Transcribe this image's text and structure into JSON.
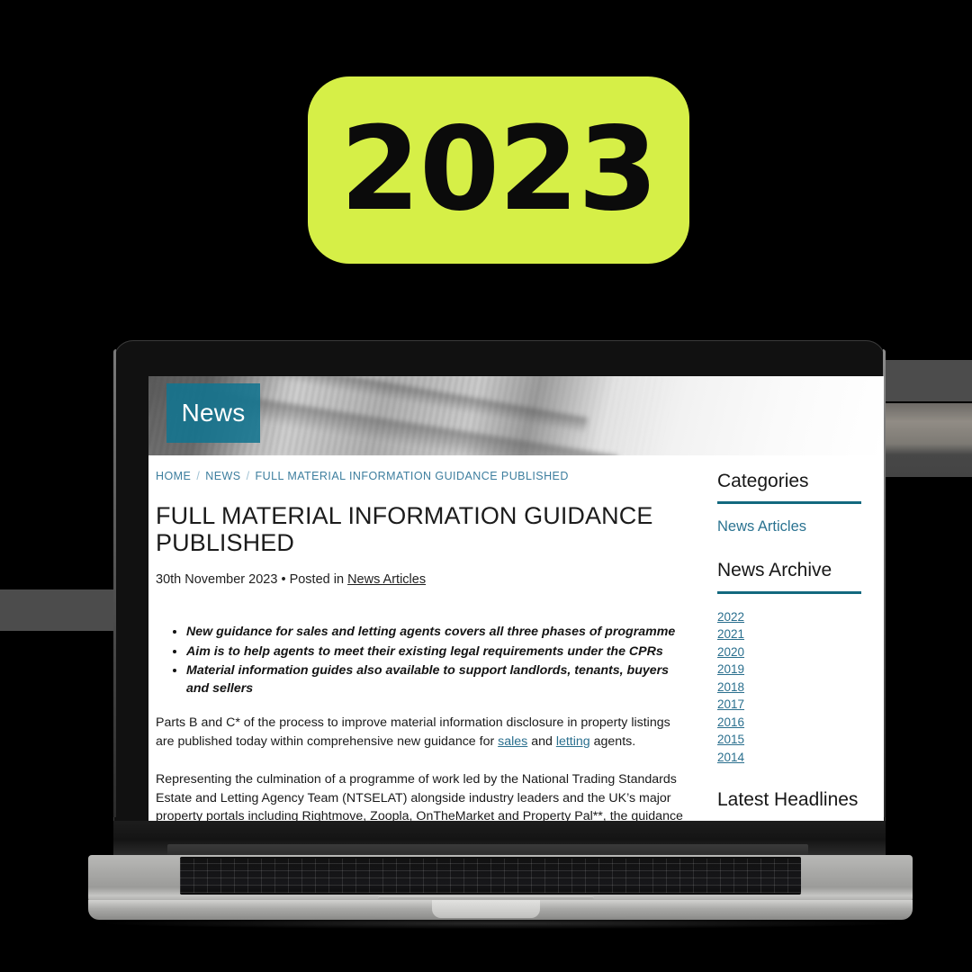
{
  "badge": {
    "year": "2023"
  },
  "site": {
    "hero_label": "News"
  },
  "breadcrumb": {
    "items": [
      {
        "label": "HOME"
      },
      {
        "label": "NEWS"
      },
      {
        "label": "FULL MATERIAL INFORMATION GUIDANCE PUBLISHED"
      }
    ],
    "separator": "/"
  },
  "article": {
    "title": "FULL MATERIAL INFORMATION GUIDANCE PUBLISHED",
    "date": "30th November 2023",
    "meta_separator": "•",
    "posted_in_label": "Posted in",
    "category_link": "News Articles",
    "key_points": [
      "New guidance for sales and letting agents covers all three phases of programme",
      "Aim is to help agents to meet their existing legal requirements under the CPRs",
      "Material information guides also available to support landlords, tenants, buyers and sellers"
    ],
    "paragraph_1": {
      "before_link_1": "Parts B and C* of the process to improve material information disclosure in property listings are published today within comprehensive new guidance for ",
      "link_1": "sales",
      "between_links": " and ",
      "link_2": "letting",
      "after_link_2": " agents."
    },
    "paragraph_2": "Representing the culmination of a programme of work led by the National Trading Standards Estate and Letting Agency Team (NTSELAT) alongside industry leaders and the UK’s major property portals including Rightmove, Zoopla, OnTheMarket and Property Pal**, the guidance has been developed in response to agents’ calls for clarity on what constitutes material information."
  },
  "sidebar": {
    "categories_heading": "Categories",
    "categories": [
      {
        "label": "News Articles"
      }
    ],
    "archive_heading": "News Archive",
    "archive_years": [
      {
        "label": "2022"
      },
      {
        "label": "2021"
      },
      {
        "label": "2020"
      },
      {
        "label": "2019"
      },
      {
        "label": "2018"
      },
      {
        "label": "2017"
      },
      {
        "label": "2016"
      },
      {
        "label": "2015"
      },
      {
        "label": "2014"
      }
    ],
    "headlines_heading": "Latest Headlines"
  },
  "colors": {
    "badge_background": "#d6ef47",
    "badge_text": "#0b0b0b",
    "hero_banner": "#12748f",
    "sidebar_rule": "#13697f",
    "link": "#2a6f8e",
    "breadcrumb": "#3d7e9e",
    "page_background": "#ffffff",
    "canvas_background": "#000000"
  }
}
